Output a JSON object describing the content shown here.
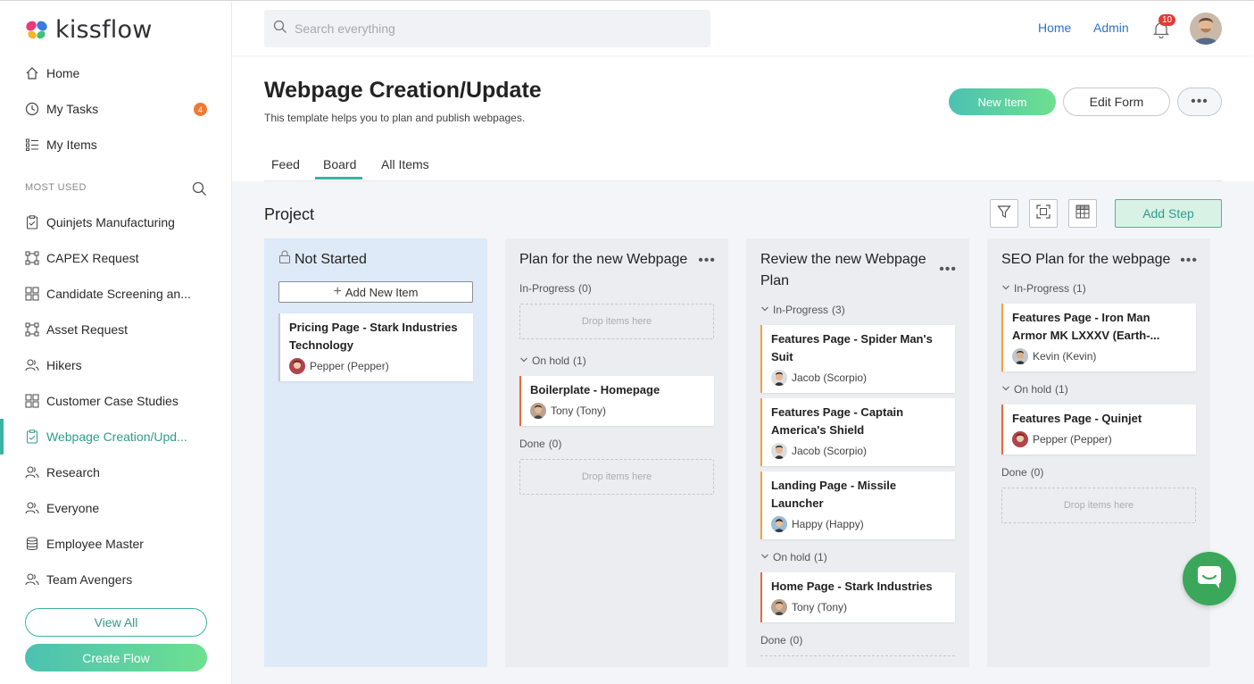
{
  "app": {
    "logo_text": "kissflow"
  },
  "sidebar": {
    "items": [
      {
        "label": "Home",
        "icon": "home-icon"
      },
      {
        "label": "My Tasks",
        "icon": "clock-icon",
        "badge": "4"
      },
      {
        "label": "My Items",
        "icon": "list-icon"
      }
    ],
    "most_used_label": "MOST USED",
    "flows": [
      {
        "label": "Quinjets Manufacturing",
        "icon": "clipboard-icon"
      },
      {
        "label": "CAPEX Request",
        "icon": "process-icon"
      },
      {
        "label": "Candidate Screening an...",
        "icon": "grid-icon"
      },
      {
        "label": "Asset Request",
        "icon": "process-icon"
      },
      {
        "label": "Hikers",
        "icon": "people-icon"
      },
      {
        "label": "Customer Case Studies",
        "icon": "grid-icon"
      },
      {
        "label": "Webpage Creation/Upd...",
        "icon": "clipboard-icon",
        "active": true
      },
      {
        "label": "Research",
        "icon": "people-icon"
      },
      {
        "label": "Everyone",
        "icon": "people-icon"
      },
      {
        "label": "Employee Master",
        "icon": "database-icon"
      },
      {
        "label": "Team Avengers",
        "icon": "people-icon"
      }
    ],
    "view_all": "View All",
    "create_flow": "Create Flow"
  },
  "topbar": {
    "search_placeholder": "Search everything",
    "home": "Home",
    "admin": "Admin",
    "notifications": "10"
  },
  "header": {
    "title": "Webpage Creation/Update",
    "subtitle": "This template helps you to plan and publish webpages.",
    "new_item": "New Item",
    "edit_form": "Edit Form"
  },
  "tabs": [
    "Feed",
    "Board",
    "All Items"
  ],
  "board": {
    "title": "Project",
    "add_step": "Add Step",
    "drop_text": "Drop items here",
    "add_new_item": "Add New Item",
    "columns": [
      {
        "title": "Not Started",
        "cards": [
          {
            "title": "Pricing Page - Stark Industries Technology",
            "user": "Pepper (Pepper)"
          }
        ]
      },
      {
        "title": "Plan for the new Webpage",
        "groups": [
          {
            "label": "In-Progress",
            "count": "(0)"
          },
          {
            "label": "On hold",
            "count": "(1)"
          },
          {
            "label": "Done",
            "count": "(0)"
          }
        ],
        "cards": [
          {
            "title": "Boilerplate - Homepage",
            "user": "Tony (Tony)"
          }
        ]
      },
      {
        "title": "Review the new Webpage Plan",
        "groups": [
          {
            "label": "In-Progress",
            "count": "(3)"
          },
          {
            "label": "On hold",
            "count": "(1)"
          },
          {
            "label": "Done",
            "count": "(0)"
          }
        ],
        "cards": [
          {
            "title": "Features Page - Spider Man's Suit",
            "user": "Jacob (Scorpio)"
          },
          {
            "title": "Features Page - Captain America's Shield",
            "user": "Jacob (Scorpio)"
          },
          {
            "title": "Landing Page - Missile Launcher",
            "user": "Happy (Happy)"
          },
          {
            "title": "Home Page - Stark Industries",
            "user": "Tony (Tony)"
          }
        ]
      },
      {
        "title": "SEO Plan for the webpage",
        "groups": [
          {
            "label": "In-Progress",
            "count": "(1)"
          },
          {
            "label": "On hold",
            "count": "(1)"
          },
          {
            "label": "Done",
            "count": "(0)"
          }
        ],
        "cards": [
          {
            "title": "Features Page - Iron Man Armor MK LXXXV (Earth-...",
            "user": "Kevin (Kevin)"
          },
          {
            "title": "Features Page - Quinjet",
            "user": "Pepper (Pepper)"
          }
        ]
      }
    ]
  },
  "colors": {
    "accent": "#3bb3a0",
    "link": "#2e73c6",
    "chat": "#3aa75a"
  }
}
